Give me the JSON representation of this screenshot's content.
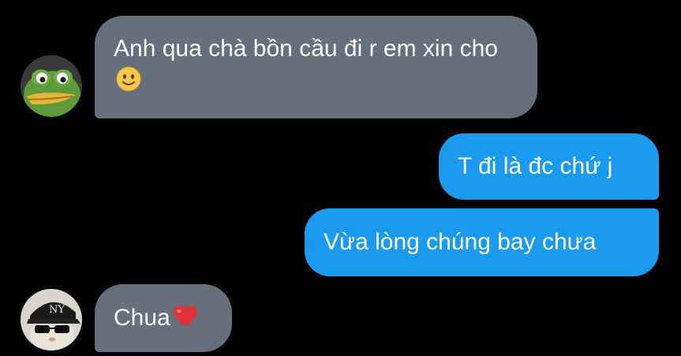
{
  "messages": [
    {
      "direction": "incoming",
      "sender_avatar": "frog-avatar",
      "text": "Anh qua chà bồn cầu đi r em xin cho",
      "emoji": "slightly-smiling-face"
    },
    {
      "direction": "outgoing",
      "text": "T đi là đc chứ j"
    },
    {
      "direction": "outgoing",
      "text": "Vừa lòng chúng bay chưa"
    },
    {
      "direction": "incoming",
      "sender_avatar": "cat-with-cap-avatar",
      "text": "Chua",
      "emoji": "red-heart"
    }
  ],
  "colors": {
    "background": "#000000",
    "incoming_bubble": "#66707c",
    "outgoing_bubble": "#1a9bf0",
    "text": "#ffffff"
  }
}
